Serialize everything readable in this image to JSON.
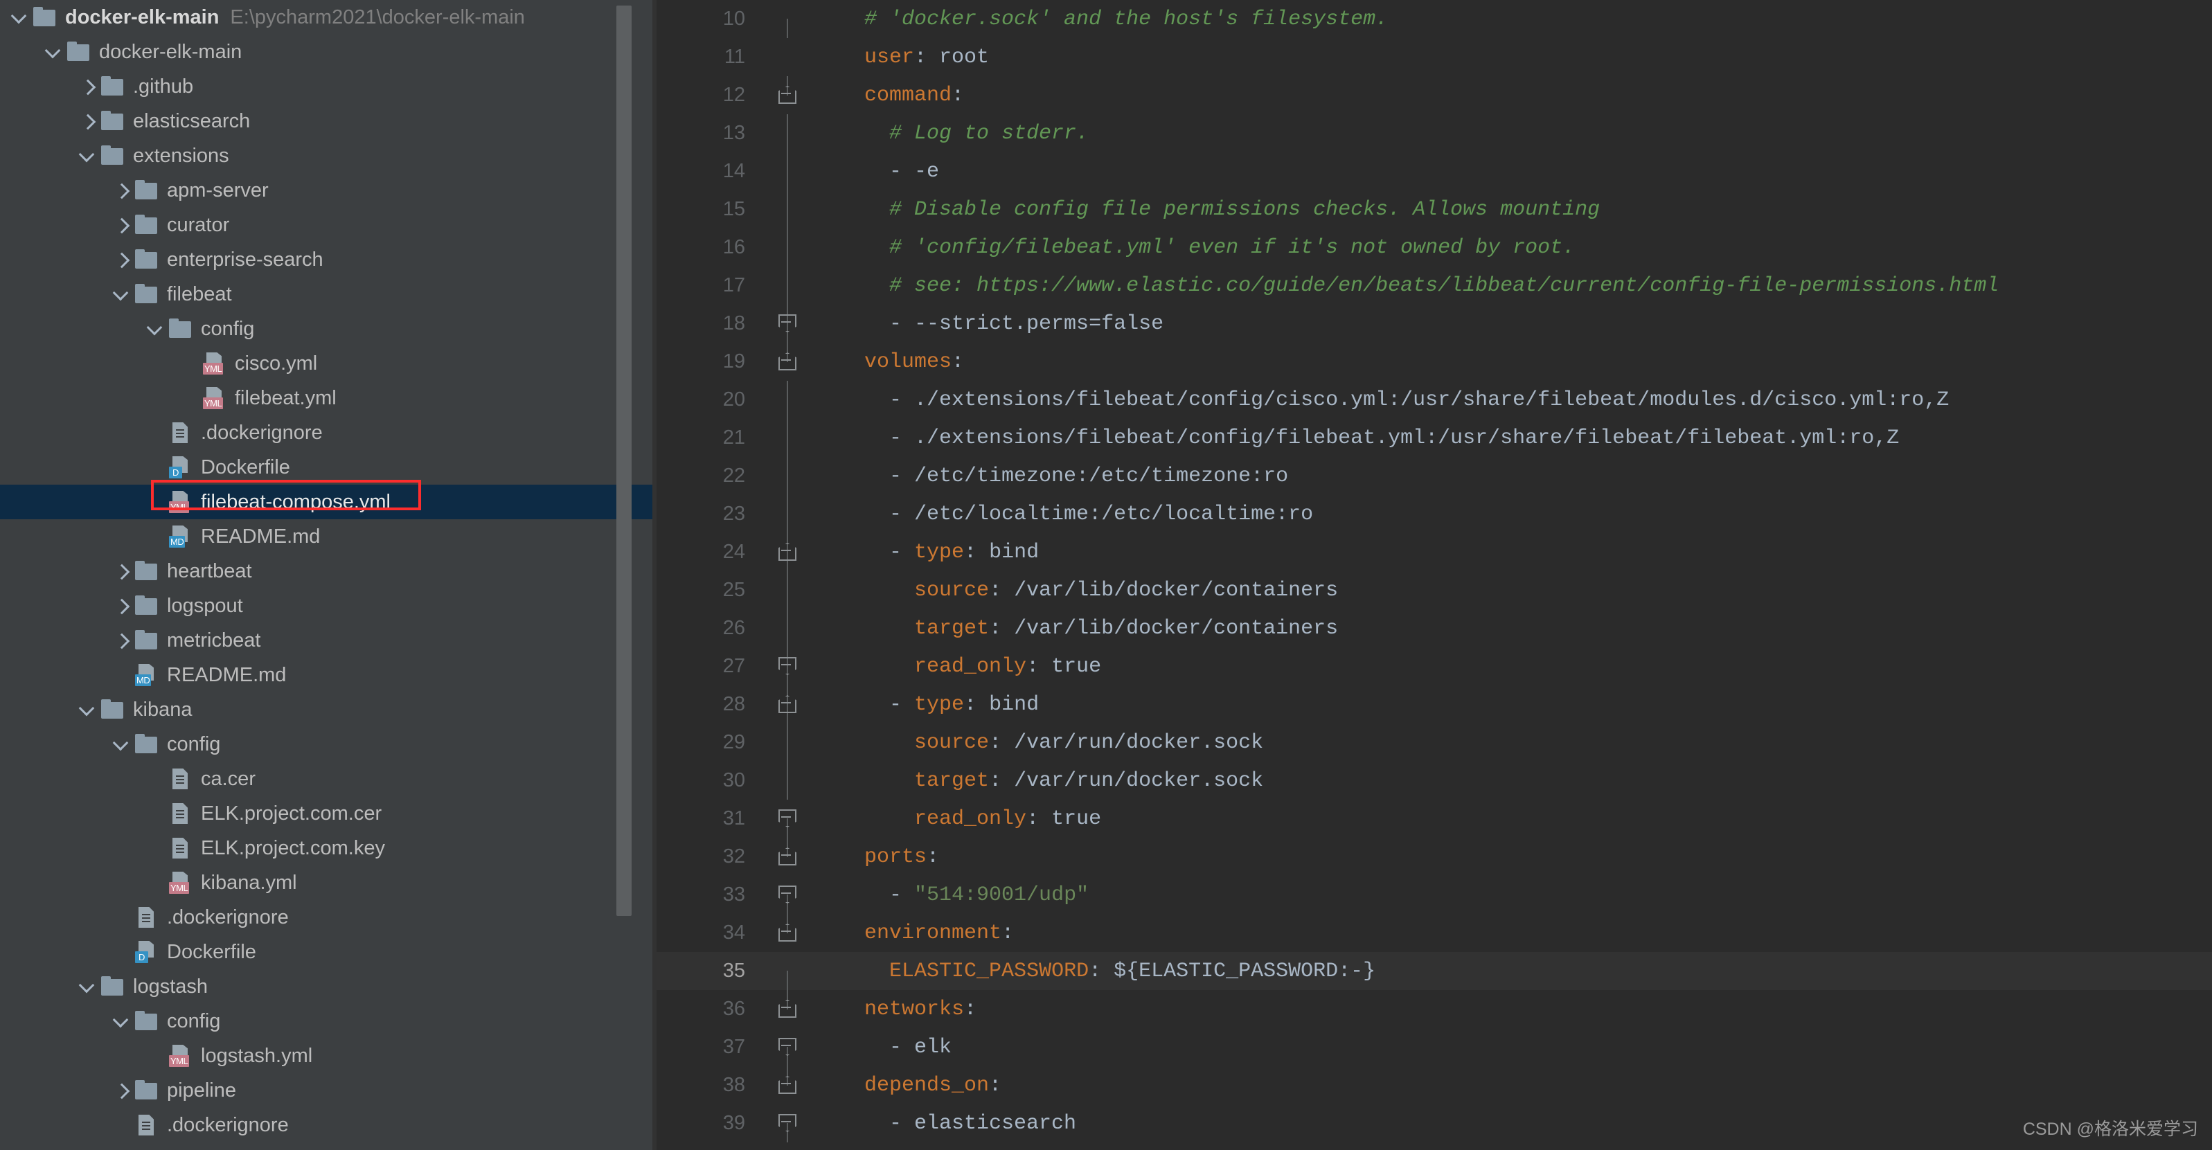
{
  "project": {
    "root_label": "docker-elk-main",
    "root_path": "E:\\pycharm2021\\docker-elk-main",
    "tree": [
      {
        "label": "docker-elk-main",
        "indent": 1,
        "twisty": "open",
        "icon": "folder"
      },
      {
        "label": ".github",
        "indent": 2,
        "twisty": "closed",
        "icon": "folder"
      },
      {
        "label": "elasticsearch",
        "indent": 2,
        "twisty": "closed",
        "icon": "folder"
      },
      {
        "label": "extensions",
        "indent": 2,
        "twisty": "open",
        "icon": "folder"
      },
      {
        "label": "apm-server",
        "indent": 3,
        "twisty": "closed",
        "icon": "folder"
      },
      {
        "label": "curator",
        "indent": 3,
        "twisty": "closed",
        "icon": "folder"
      },
      {
        "label": "enterprise-search",
        "indent": 3,
        "twisty": "closed",
        "icon": "folder"
      },
      {
        "label": "filebeat",
        "indent": 3,
        "twisty": "open",
        "icon": "folder"
      },
      {
        "label": "config",
        "indent": 4,
        "twisty": "open",
        "icon": "folder"
      },
      {
        "label": "cisco.yml",
        "indent": 5,
        "twisty": "none",
        "icon": "yml"
      },
      {
        "label": "filebeat.yml",
        "indent": 5,
        "twisty": "none",
        "icon": "yml"
      },
      {
        "label": ".dockerignore",
        "indent": 4,
        "twisty": "none",
        "icon": "doc"
      },
      {
        "label": "Dockerfile",
        "indent": 4,
        "twisty": "none",
        "icon": "dockerfile"
      },
      {
        "label": "filebeat-compose.yml",
        "indent": 4,
        "twisty": "none",
        "icon": "yml",
        "selected": true
      },
      {
        "label": "README.md",
        "indent": 4,
        "twisty": "none",
        "icon": "md"
      },
      {
        "label": "heartbeat",
        "indent": 3,
        "twisty": "closed",
        "icon": "folder"
      },
      {
        "label": "logspout",
        "indent": 3,
        "twisty": "closed",
        "icon": "folder"
      },
      {
        "label": "metricbeat",
        "indent": 3,
        "twisty": "closed",
        "icon": "folder"
      },
      {
        "label": "README.md",
        "indent": 3,
        "twisty": "none",
        "icon": "md"
      },
      {
        "label": "kibana",
        "indent": 2,
        "twisty": "open",
        "icon": "folder"
      },
      {
        "label": "config",
        "indent": 3,
        "twisty": "open",
        "icon": "folder"
      },
      {
        "label": "ca.cer",
        "indent": 4,
        "twisty": "none",
        "icon": "doc"
      },
      {
        "label": "ELK.project.com.cer",
        "indent": 4,
        "twisty": "none",
        "icon": "doc"
      },
      {
        "label": "ELK.project.com.key",
        "indent": 4,
        "twisty": "none",
        "icon": "doc"
      },
      {
        "label": "kibana.yml",
        "indent": 4,
        "twisty": "none",
        "icon": "yml"
      },
      {
        "label": ".dockerignore",
        "indent": 3,
        "twisty": "none",
        "icon": "doc"
      },
      {
        "label": "Dockerfile",
        "indent": 3,
        "twisty": "none",
        "icon": "dockerfile"
      },
      {
        "label": "logstash",
        "indent": 2,
        "twisty": "open",
        "icon": "folder"
      },
      {
        "label": "config",
        "indent": 3,
        "twisty": "open",
        "icon": "folder"
      },
      {
        "label": "logstash.yml",
        "indent": 4,
        "twisty": "none",
        "icon": "yml"
      },
      {
        "label": "pipeline",
        "indent": 3,
        "twisty": "closed",
        "icon": "folder"
      },
      {
        "label": ".dockerignore",
        "indent": 3,
        "twisty": "none",
        "icon": "doc"
      }
    ]
  },
  "editor": {
    "language": "yaml",
    "first_visible_line": 10,
    "highlighted_line": 35,
    "lines": [
      {
        "n": 10,
        "fold": "none",
        "line_style": "halftop",
        "tokens": [
          {
            "t": "    # 'docker.sock' and the host's filesystem.",
            "c": "comment"
          }
        ]
      },
      {
        "n": 11,
        "fold": "none",
        "line_style": "noline",
        "tokens": [
          {
            "t": "    ",
            "c": "punct"
          },
          {
            "t": "user",
            "c": "key"
          },
          {
            "t": ": ",
            "c": "punct"
          },
          {
            "t": "root",
            "c": "val"
          }
        ]
      },
      {
        "n": 12,
        "fold": "start",
        "line_style": "halfbot",
        "tokens": [
          {
            "t": "    ",
            "c": "punct"
          },
          {
            "t": "command",
            "c": "key"
          },
          {
            "t": ":",
            "c": "punct"
          }
        ]
      },
      {
        "n": 13,
        "fold": "none",
        "line_style": "none",
        "tokens": [
          {
            "t": "      # Log to stderr.",
            "c": "comment"
          }
        ]
      },
      {
        "n": 14,
        "fold": "none",
        "line_style": "none",
        "tokens": [
          {
            "t": "      - -e",
            "c": "val"
          }
        ]
      },
      {
        "n": 15,
        "fold": "none",
        "line_style": "none",
        "tokens": [
          {
            "t": "      # Disable config file permissions checks. Allows mounting",
            "c": "comment"
          }
        ]
      },
      {
        "n": 16,
        "fold": "none",
        "line_style": "none",
        "tokens": [
          {
            "t": "      # 'config/filebeat.yml' even if it's not owned by root.",
            "c": "comment"
          }
        ]
      },
      {
        "n": 17,
        "fold": "none",
        "line_style": "none",
        "tokens": [
          {
            "t": "      # see: https://www.elastic.co/guide/en/beats/libbeat/current/config-file-permissions.html",
            "c": "comment"
          }
        ]
      },
      {
        "n": 18,
        "fold": "end",
        "line_style": "none",
        "tokens": [
          {
            "t": "      - --strict.perms=false",
            "c": "val"
          }
        ]
      },
      {
        "n": 19,
        "fold": "start",
        "line_style": "halfbot",
        "tokens": [
          {
            "t": "    ",
            "c": "punct"
          },
          {
            "t": "volumes",
            "c": "key"
          },
          {
            "t": ":",
            "c": "punct"
          }
        ]
      },
      {
        "n": 20,
        "fold": "none",
        "line_style": "none",
        "tokens": [
          {
            "t": "      - ./extensions/filebeat/config/cisco.yml:/usr/share/filebeat/modules.d/cisco.yml:ro,Z",
            "c": "val"
          }
        ]
      },
      {
        "n": 21,
        "fold": "none",
        "line_style": "none",
        "tokens": [
          {
            "t": "      - ./extensions/filebeat/config/filebeat.yml:/usr/share/filebeat/filebeat.yml:ro,Z",
            "c": "val"
          }
        ]
      },
      {
        "n": 22,
        "fold": "none",
        "line_style": "none",
        "tokens": [
          {
            "t": "      - /etc/timezone:/etc/timezone:ro",
            "c": "val"
          }
        ]
      },
      {
        "n": 23,
        "fold": "none",
        "line_style": "none",
        "tokens": [
          {
            "t": "      - /etc/localtime:/etc/localtime:ro",
            "c": "val"
          }
        ]
      },
      {
        "n": 24,
        "fold": "start",
        "line_style": "none",
        "tokens": [
          {
            "t": "      - ",
            "c": "punct"
          },
          {
            "t": "type",
            "c": "key"
          },
          {
            "t": ": ",
            "c": "punct"
          },
          {
            "t": "bind",
            "c": "val"
          }
        ]
      },
      {
        "n": 25,
        "fold": "none",
        "line_style": "none",
        "tokens": [
          {
            "t": "        ",
            "c": "punct"
          },
          {
            "t": "source",
            "c": "key"
          },
          {
            "t": ": ",
            "c": "punct"
          },
          {
            "t": "/var/lib/docker/containers",
            "c": "val"
          }
        ]
      },
      {
        "n": 26,
        "fold": "none",
        "line_style": "none",
        "tokens": [
          {
            "t": "        ",
            "c": "punct"
          },
          {
            "t": "target",
            "c": "key"
          },
          {
            "t": ": ",
            "c": "punct"
          },
          {
            "t": "/var/lib/docker/containers",
            "c": "val"
          }
        ]
      },
      {
        "n": 27,
        "fold": "end",
        "line_style": "none",
        "tokens": [
          {
            "t": "        ",
            "c": "punct"
          },
          {
            "t": "read_only",
            "c": "key"
          },
          {
            "t": ": ",
            "c": "punct"
          },
          {
            "t": "true",
            "c": "val"
          }
        ]
      },
      {
        "n": 28,
        "fold": "start",
        "line_style": "none",
        "tokens": [
          {
            "t": "      - ",
            "c": "punct"
          },
          {
            "t": "type",
            "c": "key"
          },
          {
            "t": ": ",
            "c": "punct"
          },
          {
            "t": "bind",
            "c": "val"
          }
        ]
      },
      {
        "n": 29,
        "fold": "none",
        "line_style": "none",
        "tokens": [
          {
            "t": "        ",
            "c": "punct"
          },
          {
            "t": "source",
            "c": "key"
          },
          {
            "t": ": ",
            "c": "punct"
          },
          {
            "t": "/var/run/docker.sock",
            "c": "val"
          }
        ]
      },
      {
        "n": 30,
        "fold": "none",
        "line_style": "none",
        "tokens": [
          {
            "t": "        ",
            "c": "punct"
          },
          {
            "t": "target",
            "c": "key"
          },
          {
            "t": ": ",
            "c": "punct"
          },
          {
            "t": "/var/run/docker.sock",
            "c": "val"
          }
        ]
      },
      {
        "n": 31,
        "fold": "end",
        "line_style": "halftop",
        "tokens": [
          {
            "t": "        ",
            "c": "punct"
          },
          {
            "t": "read_only",
            "c": "key"
          },
          {
            "t": ": ",
            "c": "punct"
          },
          {
            "t": "true",
            "c": "val"
          }
        ]
      },
      {
        "n": 32,
        "fold": "start",
        "line_style": "halfbot",
        "tokens": [
          {
            "t": "    ",
            "c": "punct"
          },
          {
            "t": "ports",
            "c": "key"
          },
          {
            "t": ":",
            "c": "punct"
          }
        ]
      },
      {
        "n": 33,
        "fold": "end",
        "line_style": "halftop",
        "tokens": [
          {
            "t": "      - ",
            "c": "punct"
          },
          {
            "t": "\"514:9001/udp\"",
            "c": "str"
          }
        ]
      },
      {
        "n": 34,
        "fold": "start",
        "line_style": "halfbot",
        "tokens": [
          {
            "t": "    ",
            "c": "punct"
          },
          {
            "t": "environment",
            "c": "key"
          },
          {
            "t": ":",
            "c": "punct"
          }
        ]
      },
      {
        "n": 35,
        "fold": "none",
        "line_style": "halftop",
        "highlight": true,
        "tokens": [
          {
            "t": "      ",
            "c": "punct"
          },
          {
            "t": "ELASTIC_PASSWORD",
            "c": "key"
          },
          {
            "t": ": ",
            "c": "punct"
          },
          {
            "t": "${ELASTIC_PASSWORD:-}",
            "c": "val"
          }
        ]
      },
      {
        "n": 36,
        "fold": "start",
        "line_style": "halfbot",
        "tokens": [
          {
            "t": "    ",
            "c": "punct"
          },
          {
            "t": "networks",
            "c": "key"
          },
          {
            "t": ":",
            "c": "punct"
          }
        ]
      },
      {
        "n": 37,
        "fold": "end",
        "line_style": "halftop",
        "tokens": [
          {
            "t": "      - elk",
            "c": "val"
          }
        ]
      },
      {
        "n": 38,
        "fold": "start",
        "line_style": "halfbot",
        "tokens": [
          {
            "t": "    ",
            "c": "punct"
          },
          {
            "t": "depends_on",
            "c": "key"
          },
          {
            "t": ":",
            "c": "punct"
          }
        ]
      },
      {
        "n": 39,
        "fold": "end",
        "line_style": "halftop",
        "tokens": [
          {
            "t": "      - elasticsearch",
            "c": "val"
          }
        ]
      }
    ]
  },
  "watermark": {
    "text": "CSDN @格洛米爱学习"
  },
  "colors": {
    "pane_bg": "#3c3f41",
    "editor_bg": "#2b2b2b",
    "selection_bg": "#0d2b45",
    "annotation": "#fc2d2d",
    "key": "#cc7832",
    "value": "#a9b7c6",
    "comment": "#629755",
    "string": "#6a8759"
  }
}
